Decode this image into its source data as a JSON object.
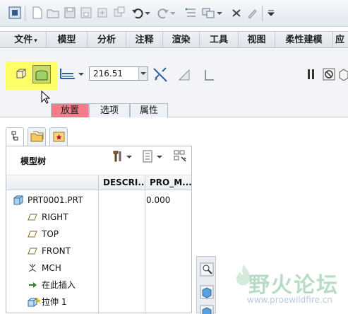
{
  "menubar": {
    "items": [
      "文件",
      "模型",
      "分析",
      "注释",
      "渲染",
      "工具",
      "视图",
      "柔性建模",
      "应"
    ]
  },
  "dashboard": {
    "depth_value": "216.51",
    "subtabs": [
      "放置",
      "选项",
      "属性"
    ],
    "active_subtab_color": "#f47c8a",
    "highlight_color": "#ffff66"
  },
  "model_tree": {
    "title": "模型树",
    "columns": [
      "DESCRI...",
      "PRO_M..."
    ],
    "items": [
      {
        "label": "PRT0001.PRT",
        "icon": "part-icon",
        "value": "0.000"
      },
      {
        "label": "RIGHT",
        "icon": "datum-plane-icon"
      },
      {
        "label": "TOP",
        "icon": "datum-plane-icon"
      },
      {
        "label": "FRONT",
        "icon": "datum-plane-icon"
      },
      {
        "label": "MCH",
        "icon": "coordinate-system-icon"
      },
      {
        "label": "在此插入",
        "icon": "insert-here-arrow-icon"
      },
      {
        "label": "拉伸 1",
        "icon": "extrude-icon"
      }
    ]
  },
  "watermark": {
    "text": "野火论坛",
    "url": "www.proewildfire.cn"
  }
}
